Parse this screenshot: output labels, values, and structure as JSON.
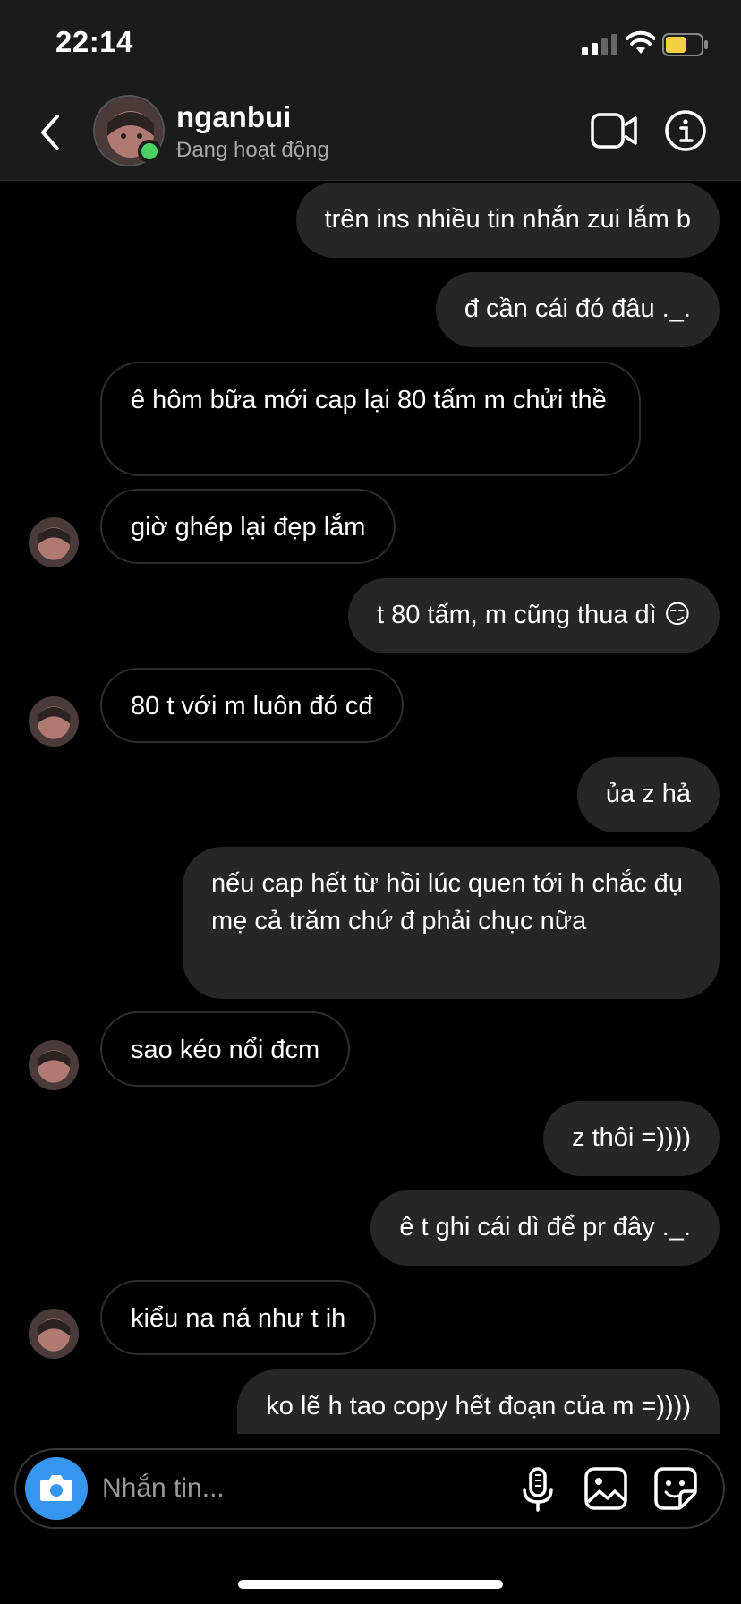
{
  "status_bar": {
    "time": "22:14"
  },
  "header": {
    "contact_name": "nganbui",
    "contact_status": "Đang hoạt động"
  },
  "messages": [
    {
      "side": "sent",
      "text": "trên ins nhiều tin nhắn zui lắm b"
    },
    {
      "side": "sent",
      "text": "đ cần cái đó đâu ._."
    },
    {
      "side": "received",
      "text": "ê hôm bữa mới cap lại 80 tấm m chửi thề"
    },
    {
      "side": "received",
      "text": "giờ ghép lại đẹp lắm"
    },
    {
      "side": "sent",
      "text": "t 80 tấm, m cũng thua dì 😏"
    },
    {
      "side": "received",
      "text": "80 t với m luôn đó cđ"
    },
    {
      "side": "sent",
      "text": "ủa z hả"
    },
    {
      "side": "sent",
      "text": "nếu cap hết từ hồi lúc quen tới h chắc đụ mẹ cả trăm chứ đ phải chục nữa"
    },
    {
      "side": "received",
      "text": "sao kéo nổi đcm"
    },
    {
      "side": "sent",
      "text": "z thôi =))))"
    },
    {
      "side": "sent",
      "text": "ê t ghi cái dì để pr đây ._."
    },
    {
      "side": "received",
      "text": "kiểu na ná như t ih"
    },
    {
      "side": "sent",
      "text": "ko lẽ h tao copy hết đoạn của m =))))"
    }
  ],
  "composer": {
    "placeholder": "Nhắn tin..."
  },
  "colors": {
    "accent": "#3797f0",
    "online": "#4bd063",
    "sent_bubble": "#262626",
    "header_bg": "#1b1b1b"
  },
  "icons": [
    "back-chevron-icon",
    "video-camera-icon",
    "info-icon",
    "camera-icon",
    "microphone-icon",
    "gallery-icon",
    "sticker-icon"
  ]
}
